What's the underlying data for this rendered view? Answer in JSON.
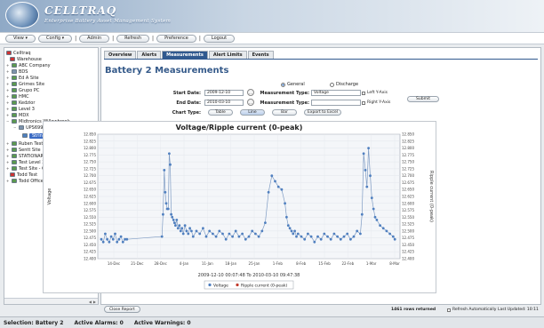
{
  "header": {
    "logo_title": "CELLTRAQ",
    "logo_subtitle": "Enterprise Battery Asset Management System"
  },
  "menu": [
    "View",
    "Config",
    "Admin",
    "Refresh",
    "Preference",
    "Logout"
  ],
  "tree": {
    "root": "Celltraq",
    "items": [
      "Warehouse",
      "ABC Company",
      "BDS",
      "Ed A Site",
      "Grimes Site",
      "Grupo PC",
      "HMC",
      "Kedzior",
      "Level 3",
      "MDX",
      "Midtronics Willowbrook",
      "UPS6990",
      "String 1",
      "Ruben Test on PW",
      "Sentt Site",
      "STATIONARY",
      "Test Level 3",
      "Test Site - CTU",
      "Todd Test",
      "Todd Office Test"
    ]
  },
  "tabs": [
    "Overview",
    "Alerts",
    "Measurements",
    "Alert Limits",
    "Events"
  ],
  "active_tab": "Measurements",
  "page_title": "Battery 2 Measurements",
  "form": {
    "mode_general": "General",
    "mode_discharge": "Discharge",
    "start_date_label": "Start Date:",
    "start_date_value": "2009-12-10",
    "end_date_label": "End Date:",
    "end_date_value": "2010-03-10",
    "meas_type_label": "Measurement Type:",
    "meas_type_value": "Voltage",
    "meas_type2_label": "Measurement Type:",
    "meas_type2_value": "",
    "left_axis": "Left Y-Axis",
    "right_axis": "Right Y-Axis",
    "submit": "Submit",
    "chart_type_label": "Chart Type:",
    "chart_types": [
      "Table",
      "Line",
      "Bar"
    ],
    "selected_chart_type": "Line",
    "export": "Export to Excel"
  },
  "chart_data": {
    "type": "line",
    "title": "Voltage/Ripple current (0-peak)",
    "ylabel": "Voltage",
    "ylabel_right": "Ripple current (0-peak)",
    "ylim": [
      12.4,
      12.85
    ],
    "y_ticks": [
      "12.850",
      "12.825",
      "12.800",
      "12.775",
      "12.750",
      "12.725",
      "12.700",
      "12.675",
      "12.650",
      "12.625",
      "12.600",
      "12.575",
      "12.550",
      "12.525",
      "12.500",
      "12.475",
      "12.450",
      "12.425",
      "12.400"
    ],
    "x_ticks": [
      "14-Dec",
      "21-Dec",
      "28-Dec",
      "4-Jan",
      "11-Jan",
      "18-Jan",
      "25-Jan",
      "1-Feb",
      "8-Feb",
      "15-Feb",
      "22-Feb",
      "1-Mar",
      "8-Mar"
    ],
    "x_range_caption": "2009-12-10 00:07:48  To  2010-03-10 09:47:38",
    "legend": [
      "Voltage",
      "Ripple current (0-peak)"
    ],
    "series_colors": [
      "#4f7fbf",
      "#c0392b"
    ],
    "x_days": [
      0,
      0.6,
      1.2,
      1.8,
      2.4,
      3.0,
      3.6,
      4.2,
      4.8,
      5.4,
      6.0,
      6.6,
      7.2,
      7.8,
      18.5,
      18.8,
      19.2,
      19.5,
      19.8,
      20.1,
      20.4,
      20.7,
      21.0,
      21.3,
      21.6,
      22.0,
      22.3,
      22.6,
      23.0,
      23.4,
      23.8,
      24.2,
      24.6,
      25.0,
      25.5,
      26.0,
      26.5,
      27.0,
      27.5,
      28.0,
      29,
      30,
      31,
      32,
      33,
      34,
      35,
      36,
      37,
      38,
      39,
      40,
      41,
      42,
      43,
      44,
      45,
      46,
      47,
      48,
      49,
      50,
      51,
      52,
      53,
      54,
      55,
      56,
      56.5,
      57,
      57.5,
      58,
      58.5,
      59,
      59.5,
      60,
      61,
      62,
      63,
      64,
      65,
      66,
      67,
      68,
      69,
      70,
      71,
      72,
      73,
      74,
      75,
      76,
      77,
      78,
      79,
      79.5,
      80,
      80.5,
      81,
      81.5,
      82,
      82.5,
      83,
      83.5,
      84,
      85,
      86,
      87,
      88,
      89,
      89.5
    ],
    "voltage": [
      12.47,
      12.46,
      12.49,
      12.47,
      12.46,
      12.48,
      12.47,
      12.49,
      12.46,
      12.47,
      12.48,
      12.46,
      12.47,
      12.47,
      12.48,
      12.56,
      12.72,
      12.64,
      12.6,
      12.58,
      12.58,
      12.78,
      12.74,
      12.56,
      12.55,
      12.54,
      12.53,
      12.52,
      12.54,
      12.51,
      12.52,
      12.5,
      12.51,
      12.49,
      12.52,
      12.5,
      12.49,
      12.51,
      12.5,
      12.48,
      12.5,
      12.49,
      12.51,
      12.48,
      12.5,
      12.49,
      12.48,
      12.5,
      12.49,
      12.47,
      12.49,
      12.48,
      12.5,
      12.48,
      12.49,
      12.47,
      12.48,
      12.5,
      12.49,
      12.48,
      12.5,
      12.53,
      12.64,
      12.7,
      12.68,
      12.66,
      12.65,
      12.6,
      12.55,
      12.52,
      12.51,
      12.5,
      12.49,
      12.5,
      12.48,
      12.49,
      12.48,
      12.47,
      12.49,
      12.48,
      12.46,
      12.48,
      12.47,
      12.49,
      12.48,
      12.47,
      12.49,
      12.48,
      12.47,
      12.48,
      12.49,
      12.47,
      12.48,
      12.5,
      12.49,
      12.56,
      12.78,
      12.72,
      12.66,
      12.8,
      12.7,
      12.62,
      12.58,
      12.55,
      12.54,
      12.52,
      12.51,
      12.5,
      12.49,
      12.48,
      12.47
    ]
  },
  "bottom": {
    "close_report": "Close Report",
    "rows_returned": "1461 rows returned",
    "refresh_auto": "Refresh Automatically",
    "last_updated": "Last Updated: 10:11"
  },
  "status": {
    "selection": "Selection: Battery 2",
    "alarms": "Active Alarms: 0",
    "warnings": "Active Warnings: 0"
  }
}
